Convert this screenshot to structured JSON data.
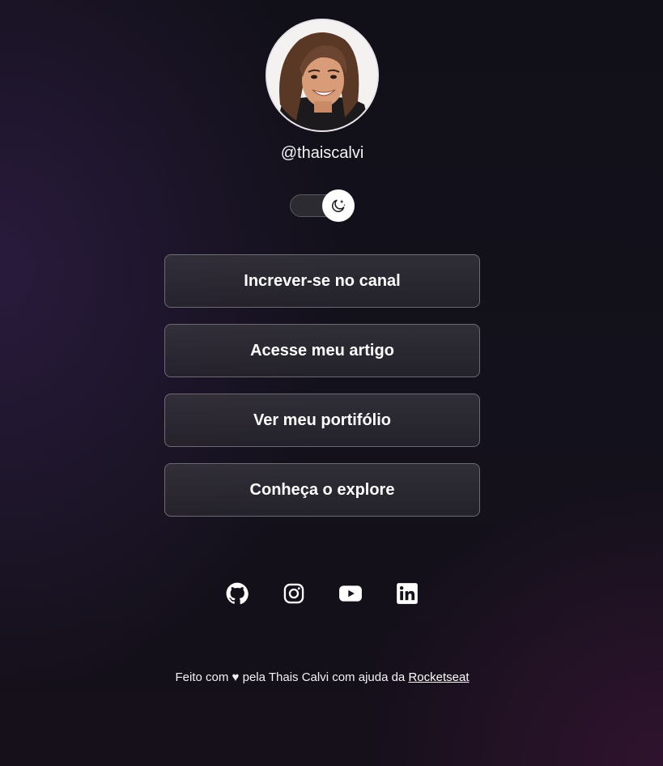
{
  "profile": {
    "username": "@thaiscalvi"
  },
  "theme_switch": {
    "state": "dark",
    "icon": "moon-stars-icon"
  },
  "links": [
    {
      "label": "Increver-se no canal"
    },
    {
      "label": "Acesse meu artigo"
    },
    {
      "label": "Ver meu portifólio"
    },
    {
      "label": "Conheça o explore"
    }
  ],
  "socials": [
    {
      "icon": "github-icon"
    },
    {
      "icon": "instagram-icon"
    },
    {
      "icon": "youtube-icon"
    },
    {
      "icon": "linkedin-icon"
    }
  ],
  "footer": {
    "prefix": "Feito com",
    "heart": "♥",
    "middle": "pela Thais Calvi com ajuda da",
    "link_text": "Rocketseat"
  },
  "colors": {
    "background": "#13111b",
    "button_border": "#6d6b72",
    "text": "#ffffff"
  }
}
